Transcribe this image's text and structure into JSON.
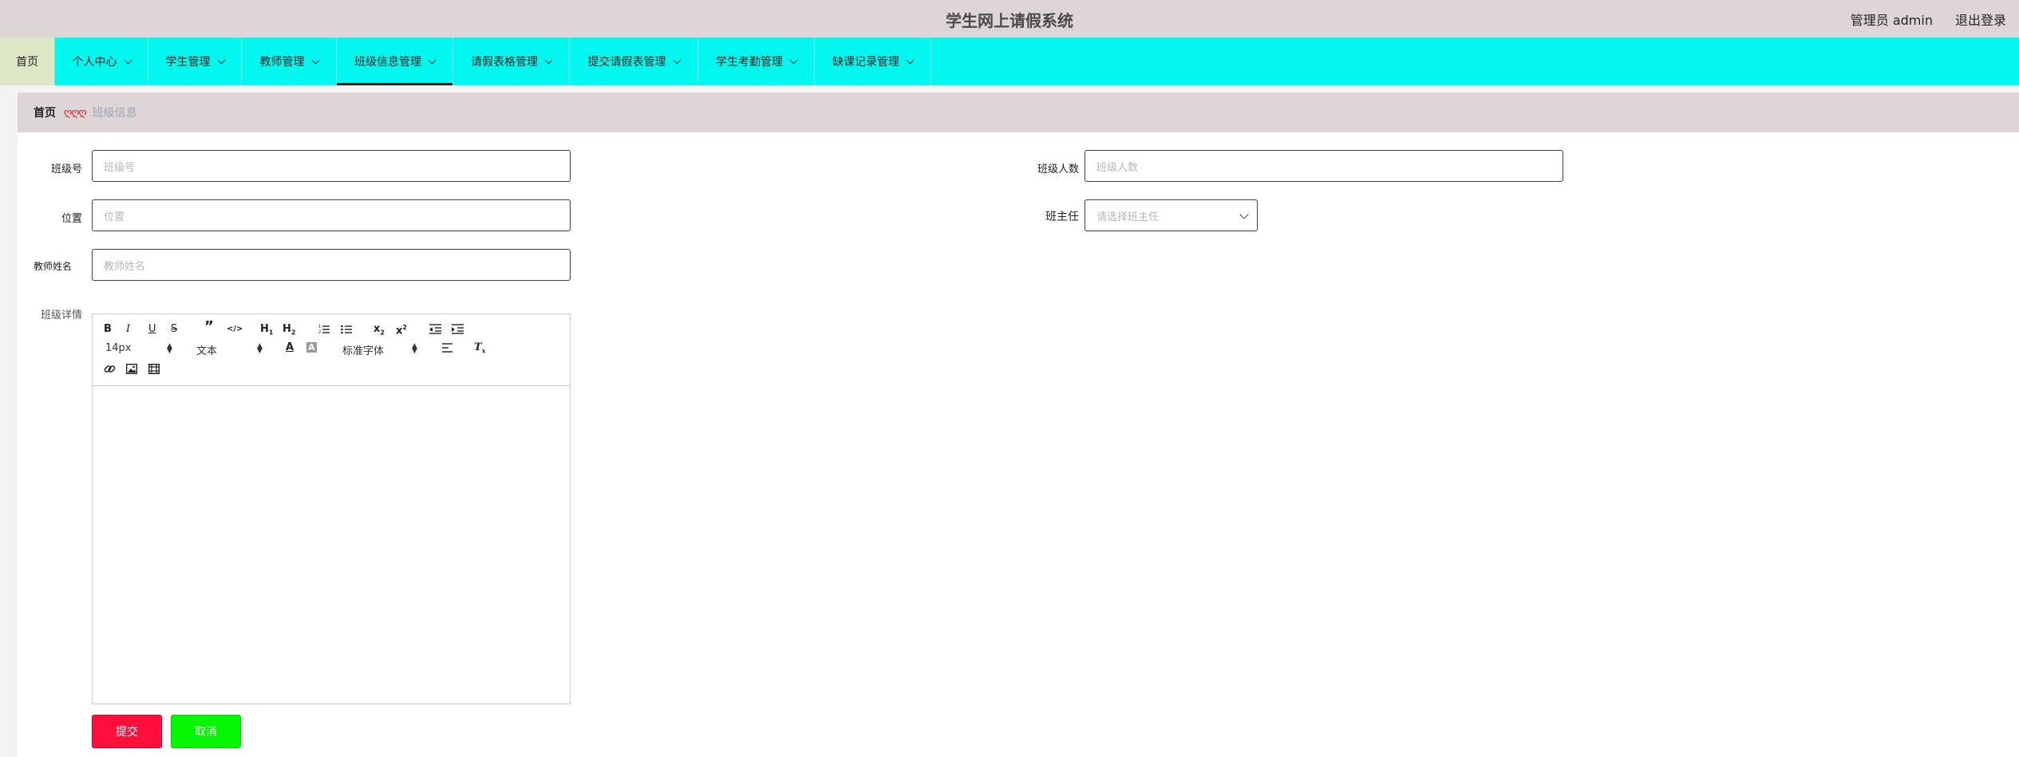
{
  "header": {
    "title": "学生网上请假系统",
    "user": "管理员 admin",
    "logout": "退出登录"
  },
  "nav": {
    "home": "首页",
    "items": [
      "个人中心",
      "学生管理",
      "教师管理",
      "班级信息管理",
      "请假表格管理",
      "提交请假表管理",
      "学生考勤管理",
      "缺课记录管理"
    ],
    "active": "班级信息管理"
  },
  "breadcrumb": {
    "home": "首页",
    "separator": "ღღღ",
    "current": "班级信息"
  },
  "form": {
    "class_no": {
      "label": "班级号",
      "placeholder": "班级号"
    },
    "class_size": {
      "label": "班级人数",
      "placeholder": "班级人数"
    },
    "location": {
      "label": "位置",
      "placeholder": "位置"
    },
    "head_teacher": {
      "label": "班主任",
      "placeholder": "请选择班主任"
    },
    "teacher_name": {
      "label": "教师姓名",
      "placeholder": "教师姓名"
    },
    "details": {
      "label": "班级详情"
    }
  },
  "editor": {
    "font_size": "14px",
    "block_type": "文本",
    "font_family": "标准字体"
  },
  "buttons": {
    "submit": "提交",
    "cancel": "取消"
  },
  "colors": {
    "topbar": "#ded5d6",
    "nav": "#02f8ee",
    "nav_home": "#dfe8c6",
    "submit": "#ff0f3a",
    "cancel": "#04f600"
  }
}
